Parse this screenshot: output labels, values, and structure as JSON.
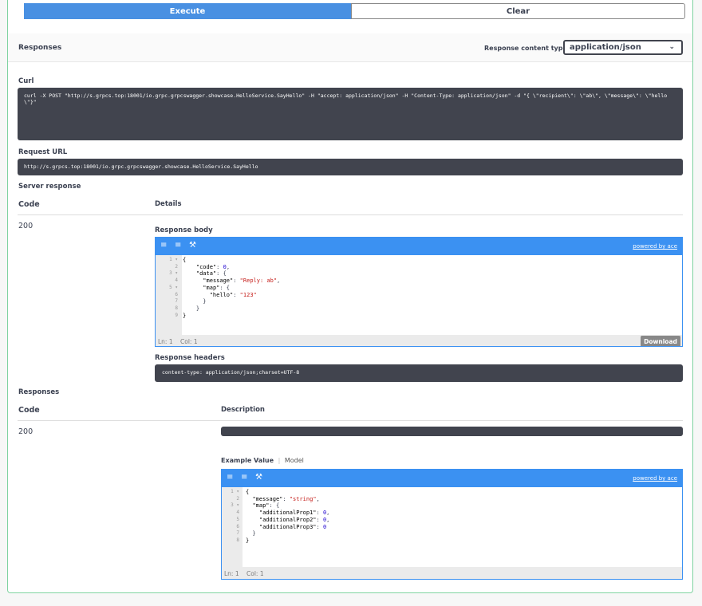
{
  "buttons": {
    "execute": "Execute",
    "clear": "Clear"
  },
  "responses_header": {
    "title": "Responses",
    "content_type_label": "Response content type",
    "content_type_value": "application/json"
  },
  "curl": {
    "label": "Curl",
    "command": "curl -X POST \"http://s.grpcs.top:18001/io.grpc.grpcswagger.showcase.HelloService.SayHello\" -H \"accept: application/json\" -H \"Content-Type: application/json\" -d \"{ \\\"recipient\\\": \\\"ab\\\", \\\"message\\\": \\\"hello\\\"}\""
  },
  "request_url": {
    "label": "Request URL",
    "value": "http://s.grpcs.top:18001/io.grpc.grpcswagger.showcase.HelloService.SayHello"
  },
  "server_response": {
    "label": "Server response",
    "col_code": "Code",
    "col_details": "Details",
    "code": "200",
    "body_label": "Response body",
    "powered_by": "powered by ace",
    "status_ln": "Ln: 1",
    "status_col": "Col: 1",
    "download": "Download",
    "headers_label": "Response headers",
    "headers_value": "content-type: application/json;charset=UTF-8"
  },
  "responses": {
    "label": "Responses",
    "col_code": "Code",
    "col_description": "Description",
    "code": "200",
    "example_value_tab": "Example Value",
    "model_tab": "Model",
    "powered_by": "powered by ace",
    "status_ln": "Ln: 1",
    "status_col": "Col: 1"
  },
  "icons": [
    "indent-icon",
    "list-icon",
    "wrench-icon",
    "chevron-down-icon"
  ],
  "colors": {
    "accent": "#4990e2",
    "ace_bar": "#3b91f2",
    "dark_block": "#41444e",
    "border_green": "#7fd3a0"
  }
}
